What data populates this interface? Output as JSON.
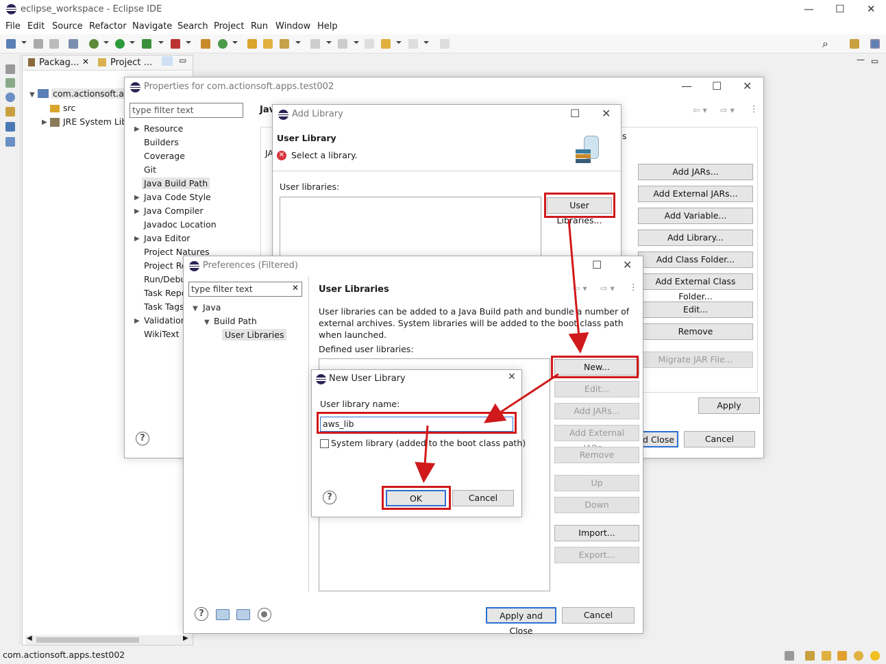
{
  "window": {
    "title": "eclipse_workspace - Eclipse IDE"
  },
  "menu": [
    "File",
    "Edit",
    "Source",
    "Refactor",
    "Navigate",
    "Search",
    "Project",
    "Run",
    "Window",
    "Help"
  ],
  "explorer": {
    "tabs": [
      "Packag...",
      "Project ..."
    ],
    "tree": [
      {
        "label": "com.actionsoft.apps",
        "icon": "project-icon"
      },
      {
        "label": "src",
        "icon": "package-folder-icon"
      },
      {
        "label": "JRE System Libr",
        "icon": "library-icon"
      }
    ]
  },
  "status": {
    "text": "com.actionsoft.apps.test002"
  },
  "properties_dialog": {
    "title": "Properties for com.actionsoft.apps.test002",
    "filter_placeholder": "type filter text",
    "header": "Jav",
    "tree": [
      "Resource",
      "Builders",
      "Coverage",
      "Git",
      "Java Build Path",
      "Java Code Style",
      "Java Compiler",
      "Javadoc Location",
      "Java Editor",
      "Project Natures",
      "Project Re",
      "Run/Debu",
      "Task Repo",
      "Task Tags",
      "Validation",
      "WikiText"
    ],
    "tab_fragment": "s",
    "ja_fragment": "JA",
    "buttons": [
      "Add JARs...",
      "Add External JARs...",
      "Add Variable...",
      "Add Library...",
      "Add Class Folder...",
      "Add External Class Folder...",
      "Edit...",
      "Remove",
      "Migrate JAR File..."
    ],
    "apply": "Apply",
    "apply_close": "d Close",
    "cancel": "Cancel"
  },
  "add_library_dialog": {
    "title": "Add Library",
    "heading": "User Library",
    "message": "Select a library.",
    "list_label": "User libraries:",
    "user_libraries_button": "User Libraries..."
  },
  "preferences_dialog": {
    "title": "Preferences (Filtered)",
    "filter_placeholder": "type filter text",
    "tree": [
      "Java",
      "Build Path",
      "User Libraries"
    ],
    "section_title": "User Libraries",
    "description": "User libraries can be added to a Java Build path and bundle a number of external archives. System libraries will be added to the boot class path when launched.",
    "defined_label": "Defined user libraries:",
    "buttons": [
      "New...",
      "Edit...",
      "Add JARs...",
      "Add External JARs...",
      "Remove",
      "Up",
      "Down",
      "Import...",
      "Export..."
    ],
    "apply_close": "Apply and Close",
    "cancel": "Cancel"
  },
  "new_user_library_dialog": {
    "title": "New User Library",
    "name_label": "User library name:",
    "name_value": "aws_lib",
    "system_checkbox": "System library (added to the boot class path)",
    "ok": "OK",
    "cancel": "Cancel"
  },
  "annotation_color": "#d0191b"
}
